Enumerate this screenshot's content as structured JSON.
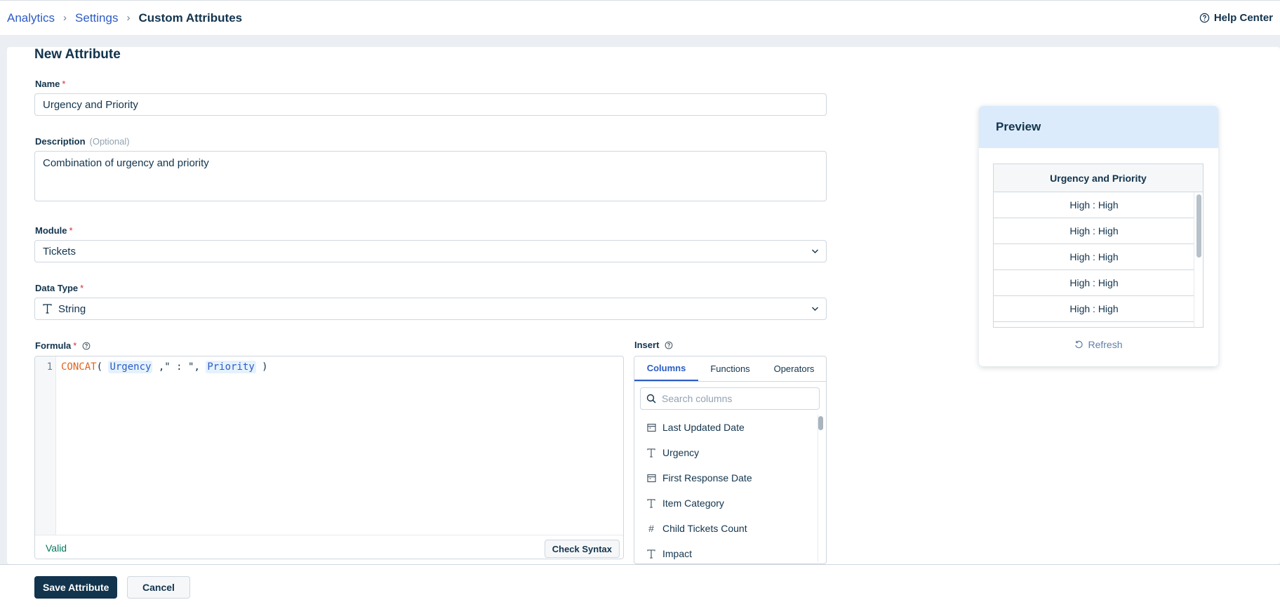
{
  "breadcrumb": {
    "items": [
      "Analytics",
      "Settings"
    ],
    "current": "Custom Attributes"
  },
  "help": {
    "label": "Help Center",
    "icon": "question-circle-icon"
  },
  "form": {
    "title": "New Attribute",
    "name": {
      "label": "Name",
      "required": "*",
      "value": "Urgency and Priority"
    },
    "description": {
      "label": "Description",
      "optional": "(Optional)",
      "value": "Combination of urgency and priority"
    },
    "module": {
      "label": "Module",
      "required": "*",
      "value": "Tickets"
    },
    "data_type": {
      "label": "Data Type",
      "required": "*",
      "value": "String",
      "icon": "text-type-icon"
    },
    "formula": {
      "label": "Formula",
      "required": "*",
      "line_number": "1",
      "tokens": {
        "fn": "CONCAT",
        "open": "( ",
        "col1": "Urgency",
        "mid": " ,\" : \", ",
        "col2": "Priority",
        "close": " )"
      },
      "status": "Valid",
      "check_label": "Check Syntax"
    },
    "insert": {
      "label": "Insert",
      "tabs": [
        "Columns",
        "Functions",
        "Operators"
      ],
      "active_tab": "Columns",
      "search_placeholder": "Search columns",
      "columns": [
        {
          "name": "Last Updated Date",
          "icon": "calendar-icon"
        },
        {
          "name": "Urgency",
          "icon": "text-type-icon"
        },
        {
          "name": "First Response Date",
          "icon": "calendar-icon"
        },
        {
          "name": "Item Category",
          "icon": "text-type-icon"
        },
        {
          "name": "Child Tickets Count",
          "icon": "hash-icon"
        },
        {
          "name": "Impact",
          "icon": "text-type-icon"
        }
      ]
    }
  },
  "preview": {
    "title": "Preview",
    "column_header": "Urgency and Priority",
    "rows": [
      "High : High",
      "High : High",
      "High : High",
      "High : High",
      "High : High"
    ],
    "refresh_label": "Refresh"
  },
  "footer": {
    "save_label": "Save Attribute",
    "cancel_label": "Cancel"
  },
  "colors": {
    "primary": "#12344d",
    "link": "#2c5cc5",
    "required": "#d72d30",
    "valid": "#00795b",
    "preview_header": "#dcebfb",
    "function_token": "#e0621e"
  }
}
